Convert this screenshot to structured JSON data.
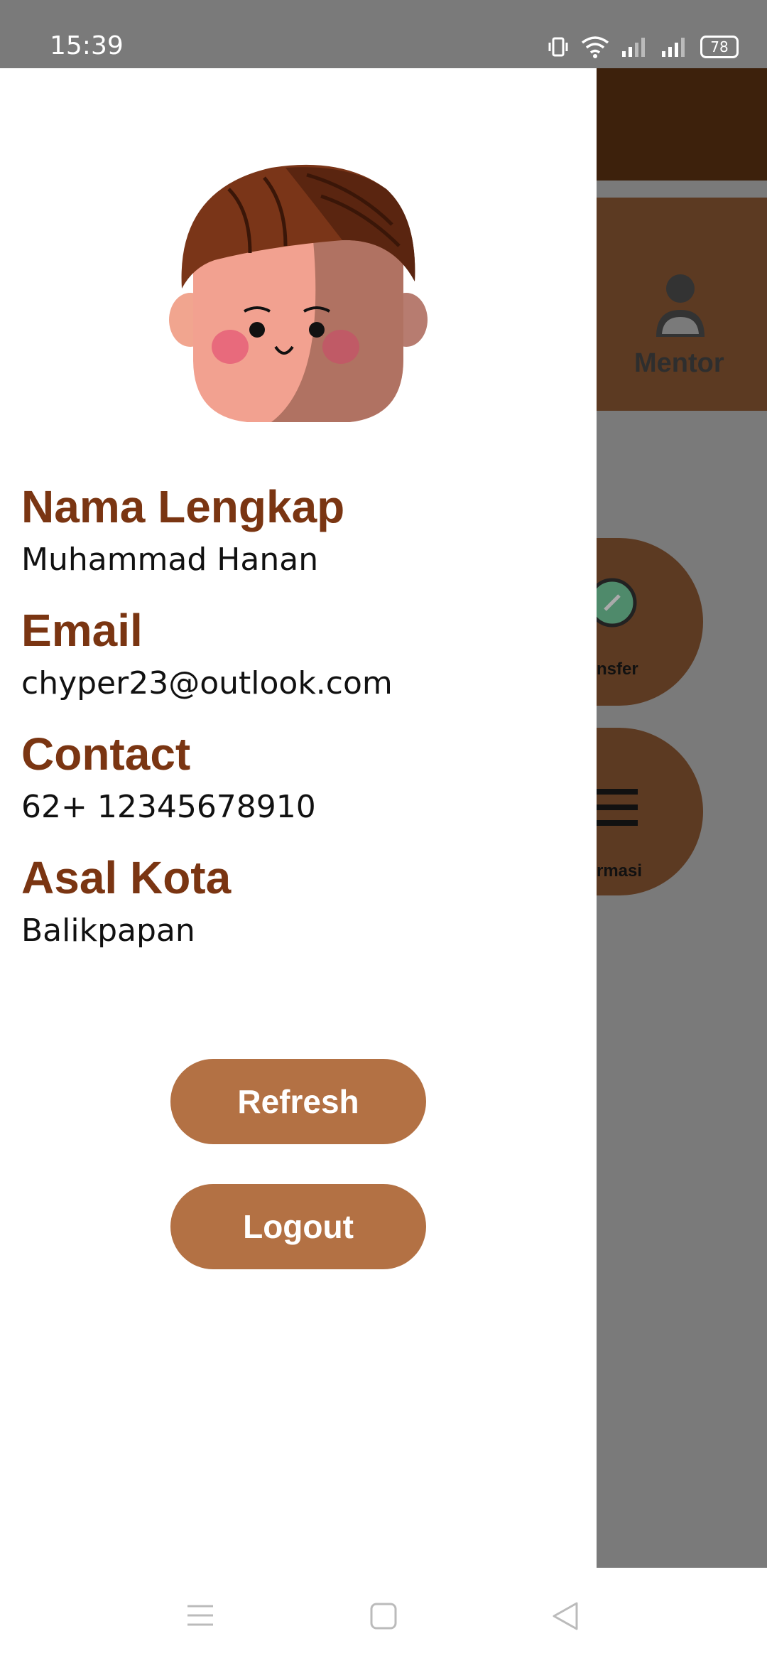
{
  "status_bar": {
    "time": "15:39",
    "battery": "78"
  },
  "background": {
    "mentor_label": "Mentor",
    "transfer_label": "nsfer",
    "info_label": "rmasi"
  },
  "profile": {
    "name_label": "Nama Lengkap",
    "name_value": "Muhammad Hanan",
    "email_label": "Email",
    "email_value": "chyper23@outlook.com",
    "contact_label": "Contact",
    "contact_value": "62+ 12345678910",
    "city_label": "Asal Kota",
    "city_value": "Balikpapan"
  },
  "buttons": {
    "refresh": "Refresh",
    "logout": "Logout"
  },
  "colors": {
    "accent": "#b37144",
    "label": "#7a3512",
    "header": "#3d210c",
    "card": "#5c3a22",
    "scrim": "#7a7a7a"
  }
}
